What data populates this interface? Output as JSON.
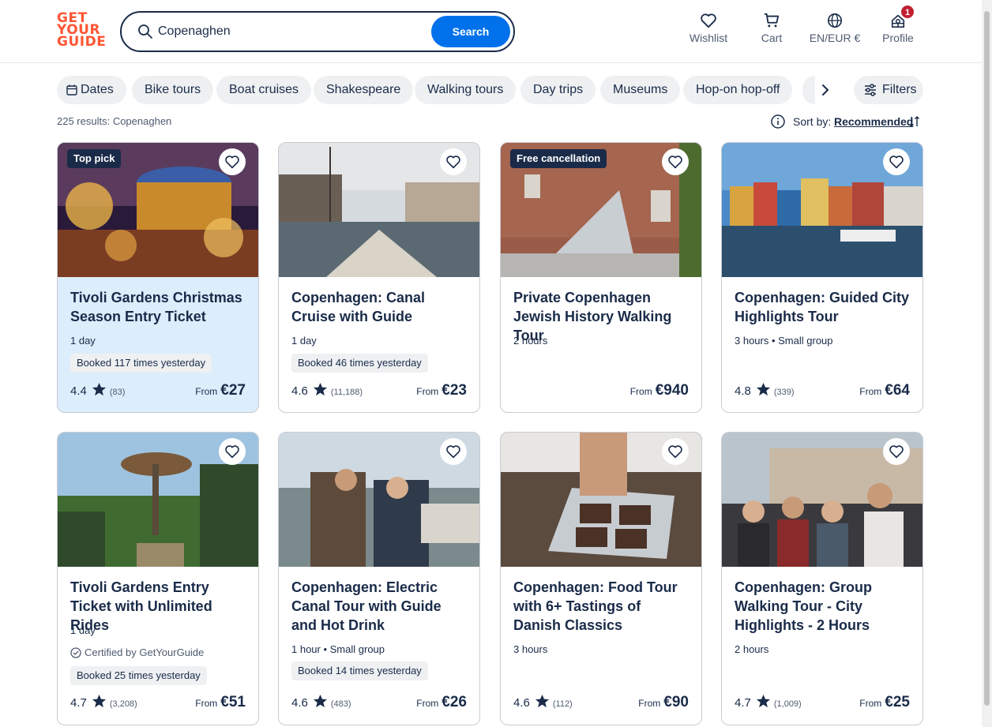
{
  "header": {
    "logo": [
      "GET",
      "YOUR",
      "GUIDE"
    ],
    "search_value": "Copenaghen",
    "search_button": "Search",
    "nav": [
      {
        "label": "Wishlist",
        "icon": "heart-icon"
      },
      {
        "label": "Cart",
        "icon": "cart-icon"
      },
      {
        "label": "EN/EUR €",
        "icon": "globe-icon"
      },
      {
        "label": "Profile",
        "icon": "profile-icon",
        "badge": "1"
      }
    ]
  },
  "chips": [
    "Dates",
    "Bike tours",
    "Boat cruises",
    "Shakespeare",
    "Walking tours",
    "Day trips",
    "Museums",
    "Hop-on hop-off"
  ],
  "filters_label": "Filters",
  "results_text": "225 results: Copenaghen",
  "sort": {
    "label": "Sort by:",
    "value": "Recommended"
  },
  "colors": {
    "accent": "#0071eb",
    "brand": "#ff5533",
    "text": "#1a2b49",
    "badge": "#c11f32",
    "highlight": "#dcedfc"
  },
  "cards": [
    {
      "tag": "Top pick",
      "title": "Tivoli Gardens Christmas Season Entry Ticket",
      "meta": "1 day",
      "booked": "Booked 117 times yesterday",
      "rating": "4.4",
      "reviews": "(83)",
      "from": "From",
      "price": "€27"
    },
    {
      "tag": "",
      "title": "Copenhagen: Canal Cruise with Guide",
      "meta": "1 day",
      "booked": "Booked 46 times yesterday",
      "rating": "4.6",
      "reviews": "(11,188)",
      "from": "From",
      "price": "€23"
    },
    {
      "tag": "Free cancellation",
      "title": "Private Copenhagen Jewish History Walking Tour",
      "meta": "2 hours",
      "booked": "",
      "rating": "",
      "reviews": "",
      "from": "From",
      "price": "€940"
    },
    {
      "tag": "",
      "title": "Copenhagen: Guided City Highlights Tour",
      "meta": "3 hours • Small group",
      "booked": "",
      "rating": "4.8",
      "reviews": "(339)",
      "from": "From",
      "price": "€64"
    },
    {
      "tag": "",
      "title": "Tivoli Gardens Entry Ticket with Unlimited Rides",
      "meta": "1 day",
      "cert": "Certified by GetYourGuide",
      "booked": "Booked 25 times yesterday",
      "rating": "4.7",
      "reviews": "(3,208)",
      "from": "From",
      "price": "€51"
    },
    {
      "tag": "",
      "title": "Copenhagen: Electric Canal Tour with Guide and Hot Drink",
      "meta": "1 hour • Small group",
      "booked": "Booked 14 times yesterday",
      "rating": "4.6",
      "reviews": "(483)",
      "from": "From",
      "price": "€26"
    },
    {
      "tag": "",
      "title": "Copenhagen: Food Tour with 6+ Tastings of Danish Classics",
      "meta": "3 hours",
      "booked": "",
      "rating": "4.6",
      "reviews": "(112)",
      "from": "From",
      "price": "€90"
    },
    {
      "tag": "",
      "title": "Copenhagen: Group Walking Tour - City Highlights - 2 Hours",
      "meta": "2 hours",
      "booked": "",
      "rating": "4.7",
      "reviews": "(1,009)",
      "from": "From",
      "price": "€25"
    }
  ]
}
